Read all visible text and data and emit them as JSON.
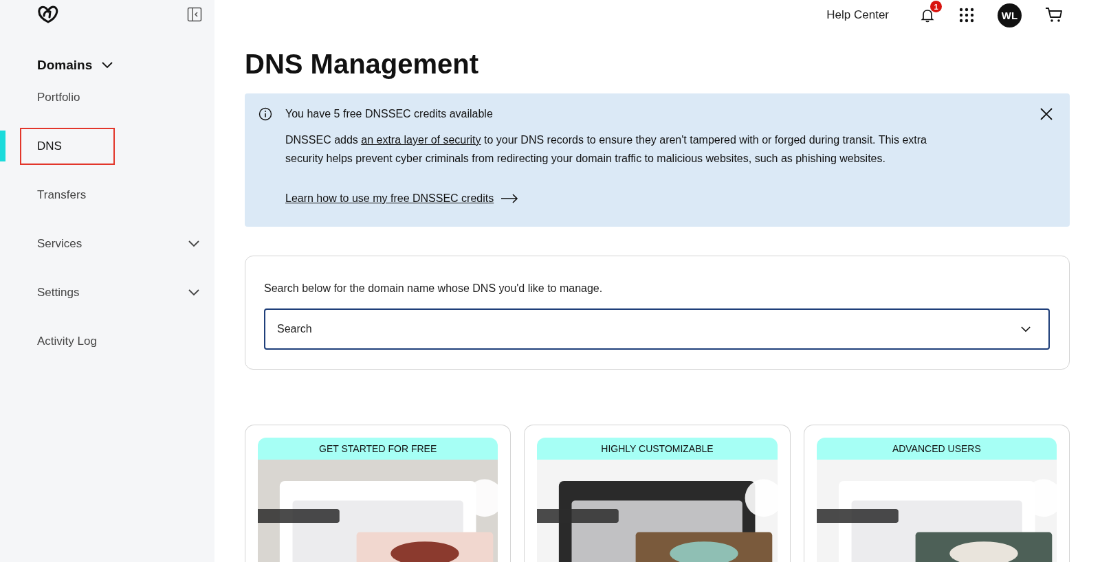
{
  "sidebar": {
    "section": {
      "label": "Domains",
      "expanded": true
    },
    "items": [
      {
        "label": "Portfolio",
        "selected": false,
        "has_menu": false
      },
      {
        "label": "DNS",
        "selected": true,
        "has_menu": false
      },
      {
        "label": "Transfers",
        "selected": false,
        "has_menu": false
      },
      {
        "label": "Services",
        "selected": false,
        "has_menu": true
      },
      {
        "label": "Settings",
        "selected": false,
        "has_menu": true
      },
      {
        "label": "Activity Log",
        "selected": false,
        "has_menu": false
      }
    ]
  },
  "header": {
    "help": "Help Center",
    "notifications": "1",
    "avatar": "WL"
  },
  "title": "DNS Management",
  "alert": {
    "title": "You have 5 free DNSSEC credits available",
    "text_before": "DNSSEC adds",
    "link": "an extra layer of security",
    "text_after": "to your DNS records to ensure they aren't tampered with or forged during transit. This extra security helps prevent cyber criminals from redirecting your domain traffic to malicious websites, such as phishing websites.",
    "action": "Learn how to use my free DNSSEC credits"
  },
  "search": {
    "prompt": "Search below for the domain name whose DNS you'd like to manage.",
    "placeholder": "Search"
  },
  "cards": [
    {
      "heading": "GET STARTED FOR FREE",
      "kind": "picture"
    },
    {
      "heading": "HIGHLY CUSTOMIZABLE",
      "kind": "picture"
    },
    {
      "heading": "ADVANCED USERS",
      "kind": "picture"
    }
  ]
}
